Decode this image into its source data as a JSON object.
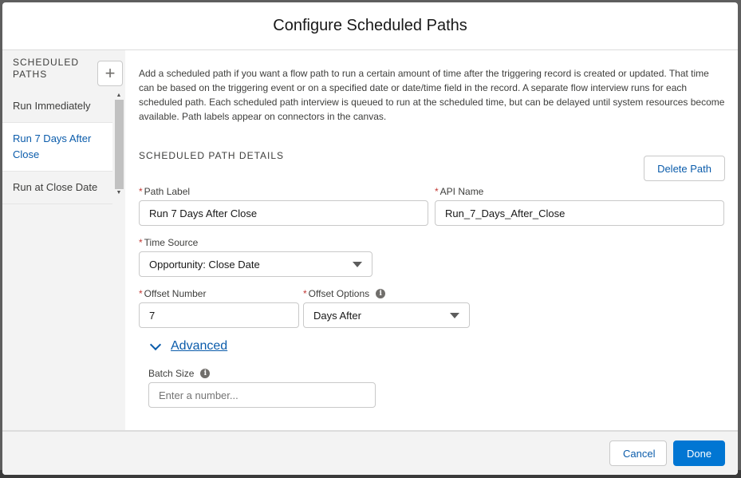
{
  "modal": {
    "title": "Configure Scheduled Paths"
  },
  "sidebar": {
    "heading": "SCHEDULED PATHS",
    "add_label": "+",
    "items": [
      {
        "label": "Run Immediately"
      },
      {
        "label": "Run 7 Days After Close"
      },
      {
        "label": "Run at Close Date"
      }
    ]
  },
  "content": {
    "intro": "Add a scheduled path if you want a flow path to run a certain amount of time after the triggering record is created or updated. That time can be based on the triggering event or on a specified date or date/time field in the record. A separate flow interview runs for each scheduled path. Each scheduled path interview is queued to run at the scheduled time, but can be delayed until system resources become available. Path labels appear on connectors in the canvas.",
    "section_title": "SCHEDULED PATH DETAILS",
    "delete_label": "Delete Path",
    "path_label": {
      "label": "Path Label",
      "value": "Run 7 Days After Close"
    },
    "api_name": {
      "label": "API Name",
      "value": "Run_7_Days_After_Close"
    },
    "time_source": {
      "label": "Time Source",
      "value": "Opportunity: Close Date"
    },
    "offset_number": {
      "label": "Offset Number",
      "value": "7"
    },
    "offset_options": {
      "label": "Offset Options",
      "value": "Days After"
    },
    "advanced_label": "Advanced",
    "batch_size": {
      "label": "Batch Size",
      "placeholder": "Enter a number..."
    }
  },
  "footer": {
    "cancel_label": "Cancel",
    "done_label": "Done"
  },
  "colors": {
    "brand": "#0176d3",
    "link": "#0b5cab",
    "required": "#c23934"
  },
  "icons": [
    "add-icon",
    "info-icon",
    "chevron-down-icon",
    "caret-down-icon"
  ]
}
